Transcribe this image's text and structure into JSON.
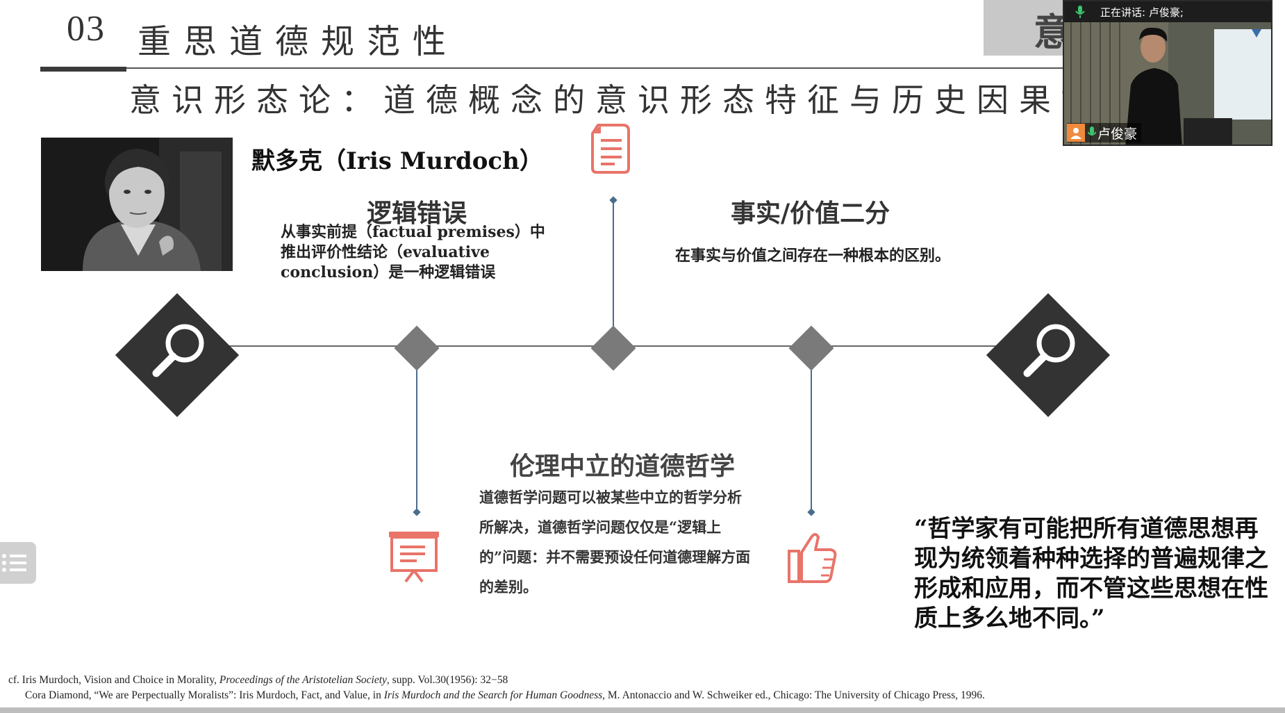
{
  "header": {
    "section_number": "03",
    "section_title": "重思道德规范性",
    "subtitle": "意识形态论：道德概念的意识形态特征与历史因果链",
    "corner_char": "意"
  },
  "philosopher": {
    "name": "默多克（Iris Murdoch）"
  },
  "points": {
    "logic": {
      "heading": "逻辑错误",
      "text": "从事实前提（factual premises）中推出评价性结论（evaluative conclusion）是一种逻辑错误"
    },
    "fact_value": {
      "heading": "事实/价值二分",
      "text": "在事实与价值之间存在一种根本的区别。"
    },
    "neutral": {
      "heading": "伦理中立的道德哲学",
      "text": "道德哲学问题可以被某些中立的哲学分析所解决，道德哲学问题仅仅是“逻辑上的”问题：并不需要预设任何道德理解方面的差别。"
    }
  },
  "quote": "“哲学家有可能把所有道德思想再现为统领着种种选择的普遍规律之形成和应用，而不管这些思想在性质上多么地不同。”",
  "references": {
    "ref1_pre": "cf. Iris Murdoch, Vision and Choice in Morality, ",
    "ref1_journal": "Proceedings of the Aristotelian Society",
    "ref1_post": ", supp. Vol.30(1956): 32−58",
    "ref2_pre": "Cora Diamond, “We are Perpectually Moralists”: Iris Murdoch, Fact, and Value, in ",
    "ref2_book": "Iris Murdoch and the Search for Human Goodness,",
    "ref2_post": " M. Antonaccio and W. Schweiker ed., Chicago: The University of Chicago Press, 1996."
  },
  "video": {
    "speaking_label": "正在讲话: 卢俊豪;",
    "participant_name": "卢俊豪"
  },
  "colors": {
    "diamond_dark": "#333333",
    "diamond_gray": "#7a7a7a",
    "connector_blue": "#4a6d8c",
    "icon_salmon": "#e8746a"
  }
}
